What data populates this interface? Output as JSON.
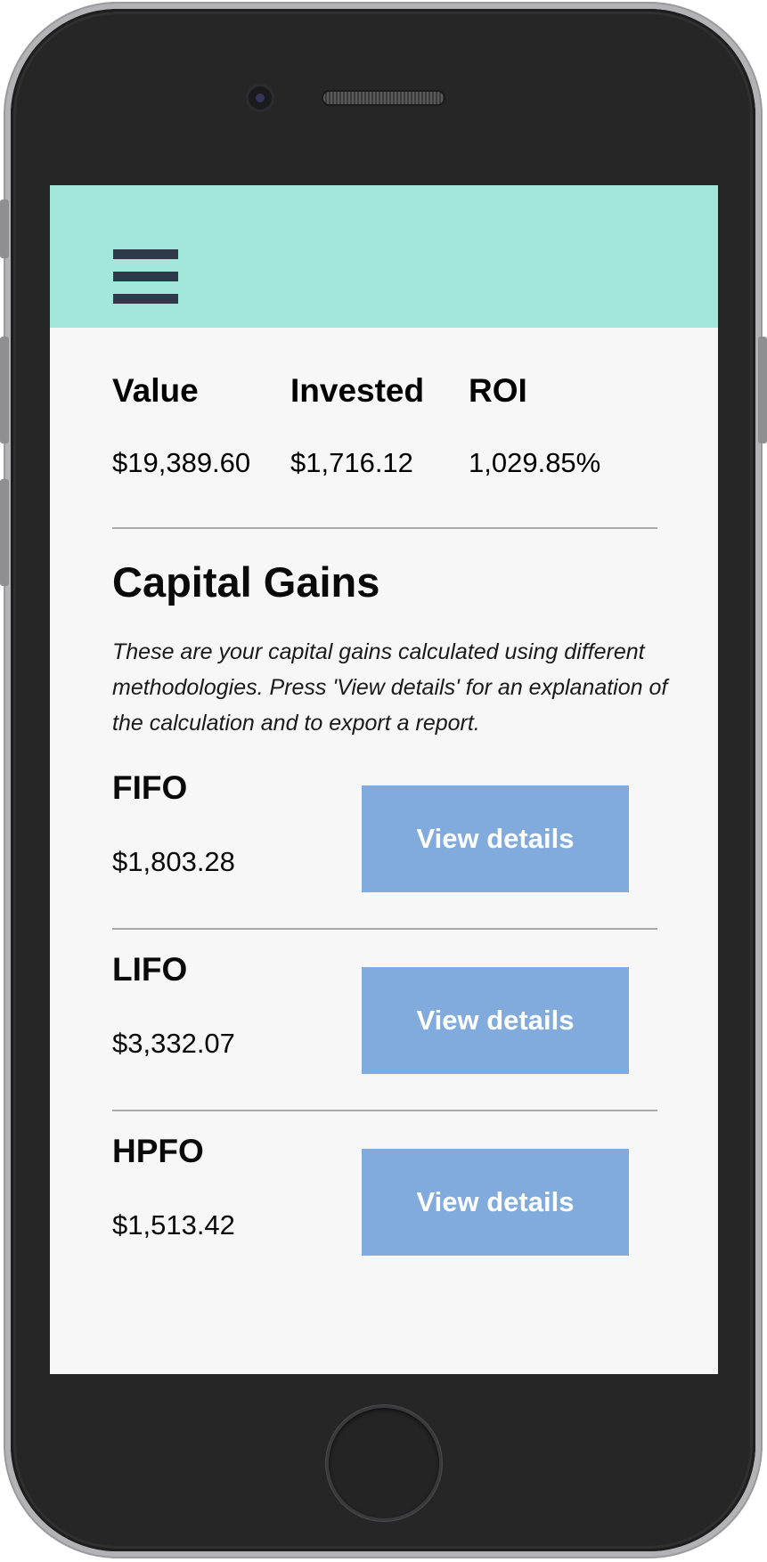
{
  "header": {
    "menu_icon": "hamburger-menu-icon",
    "background_color": "#a2e7d9"
  },
  "summary": {
    "value": {
      "label": "Value",
      "amount": "$19,389.60"
    },
    "invested": {
      "label": "Invested",
      "amount": "$1,716.12"
    },
    "roi": {
      "label": "ROI",
      "amount": "1,029.85%"
    }
  },
  "capital_gains": {
    "title": "Capital Gains",
    "description": "These are your capital gains calculated using different methodologies. Press 'View details' for an explanation of the calculation and to export a report.",
    "methods": [
      {
        "name": "FIFO",
        "amount": "$1,803.28",
        "button_label": "View details"
      },
      {
        "name": "LIFO",
        "amount": "$3,332.07",
        "button_label": "View details"
      },
      {
        "name": "HPFO",
        "amount": "$1,513.42",
        "button_label": "View details"
      }
    ],
    "button_color": "#80abdc"
  }
}
